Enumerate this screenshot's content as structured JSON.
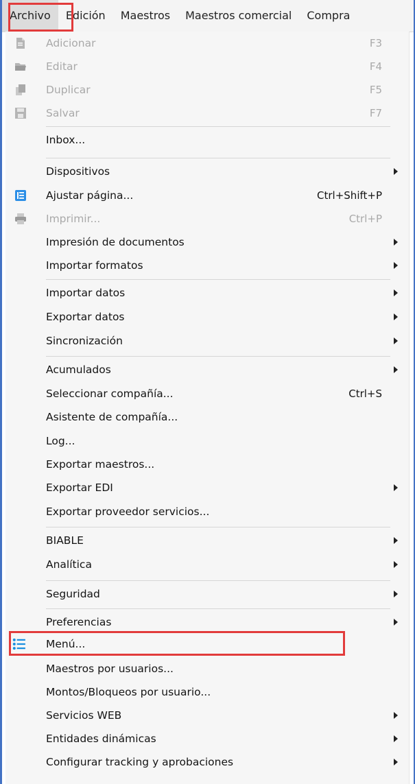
{
  "menubar": {
    "items": [
      {
        "label": "Archivo",
        "active": true
      },
      {
        "label": "Edición"
      },
      {
        "label": "Maestros"
      },
      {
        "label": "Maestros comercial"
      },
      {
        "label": "Compra"
      }
    ]
  },
  "dropdown": {
    "items": [
      {
        "label": "Adicionar",
        "shortcut": "F3",
        "disabled": true,
        "icon": "add-document-icon"
      },
      {
        "label": "Editar",
        "shortcut": "F4",
        "disabled": true,
        "icon": "folder-open-icon"
      },
      {
        "label": "Duplicar",
        "shortcut": "F5",
        "disabled": true,
        "icon": "copy-icon"
      },
      {
        "label": "Salvar",
        "shortcut": "F7",
        "disabled": true,
        "icon": "save-icon"
      },
      {
        "label": "Inbox..."
      },
      {
        "label": "Dispositivos",
        "submenu": true
      },
      {
        "label": "Ajustar página...",
        "shortcut": "Ctrl+Shift+P",
        "icon": "page-setup-icon"
      },
      {
        "label": "Imprimir...",
        "shortcut": "Ctrl+P",
        "disabled": true,
        "icon": "printer-icon"
      },
      {
        "label": "Impresión de documentos",
        "submenu": true
      },
      {
        "label": "Importar formatos",
        "submenu": true
      },
      {
        "label": "Importar datos",
        "submenu": true
      },
      {
        "label": "Exportar datos",
        "submenu": true
      },
      {
        "label": "Sincronización",
        "submenu": true
      },
      {
        "label": "Acumulados",
        "submenu": true
      },
      {
        "label": "Seleccionar compañía...",
        "shortcut": "Ctrl+S"
      },
      {
        "label": "Asistente de compañía..."
      },
      {
        "label": "Log..."
      },
      {
        "label": "Exportar maestros..."
      },
      {
        "label": "Exportar EDI",
        "submenu": true
      },
      {
        "label": "Exportar proveedor servicios..."
      },
      {
        "label": "BIABLE",
        "submenu": true
      },
      {
        "label": "Analítica",
        "submenu": true
      },
      {
        "label": "Seguridad",
        "submenu": true
      },
      {
        "label": "Preferencias",
        "submenu": true
      },
      {
        "label": "Menú...",
        "icon": "list-icon",
        "highlighted": true
      },
      {
        "label": "Maestros por usuarios..."
      },
      {
        "label": "Montos/Bloqueos por usuario..."
      },
      {
        "label": "Servicios WEB",
        "submenu": true
      },
      {
        "label": "Entidades dinámicas",
        "submenu": true
      },
      {
        "label": "Configurar tracking y aprobaciones",
        "submenu": true
      }
    ]
  },
  "colors": {
    "highlight": "#e23b3b",
    "accent": "#4472c4",
    "menu_background": "#f6f6f6",
    "disabled_text": "#a9a9a9"
  }
}
